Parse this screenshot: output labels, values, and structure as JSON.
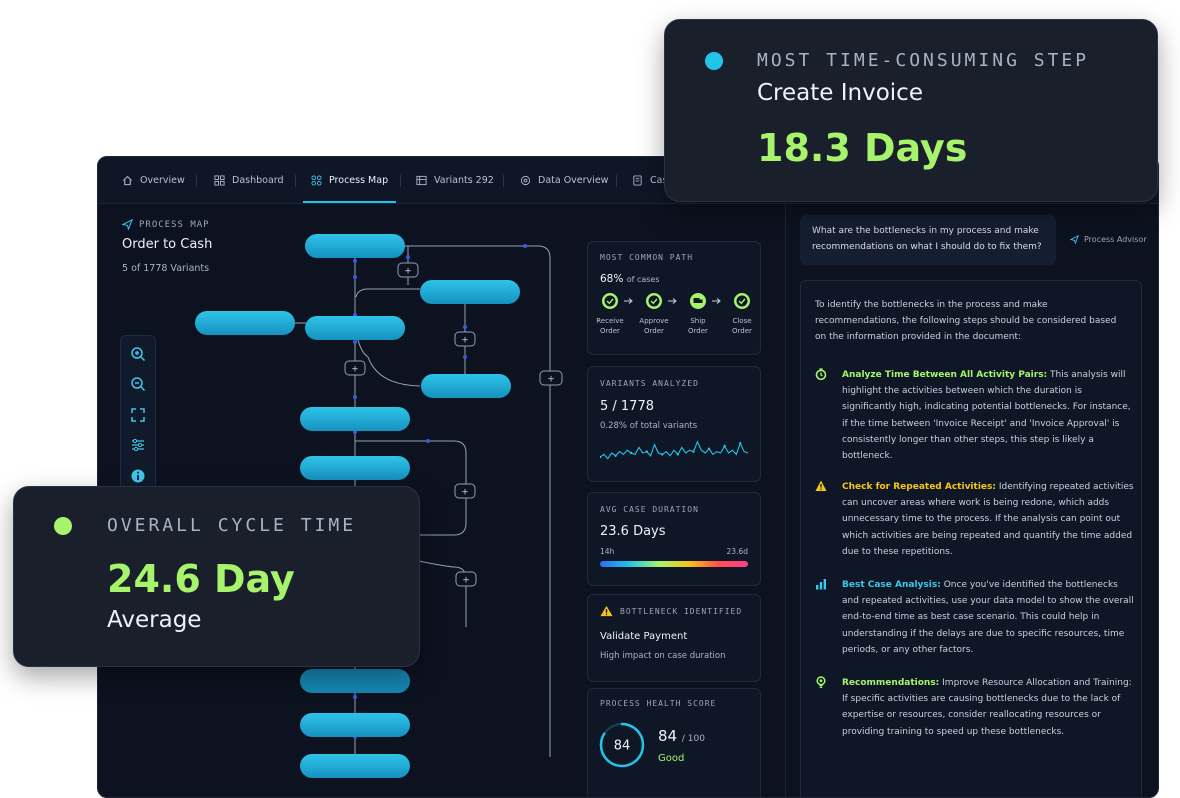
{
  "tabs": [
    {
      "label": "Overview",
      "icon": "home-icon"
    },
    {
      "label": "Dashboard",
      "icon": "dashboard-icon"
    },
    {
      "label": "Process Map",
      "icon": "process-map-icon"
    },
    {
      "label": "Variants 292",
      "icon": "variants-icon"
    },
    {
      "label": "Data Overview",
      "icon": "data-overview-icon"
    },
    {
      "label": "Cas",
      "icon": "cases-icon"
    }
  ],
  "active_tab": "Process Map",
  "process_map": {
    "header": "PROCESS MAP",
    "title": "Order to Cash",
    "subtitle": "5 of 1778 Variants"
  },
  "tools": [
    "zoom-in-icon",
    "zoom-out-icon",
    "fit-view-icon",
    "filter-sliders-icon",
    "info-icon"
  ],
  "metrics": {
    "common_path": {
      "label": "MOST COMMON PATH",
      "percent": "68%",
      "percent_suffix": "of cases",
      "steps": [
        {
          "line1": "Receive",
          "line2": "Order"
        },
        {
          "line1": "Approve",
          "line2": "Order"
        },
        {
          "line1": "Ship",
          "line2": "Order"
        },
        {
          "line1": "Close",
          "line2": "Order"
        }
      ],
      "step_icons": [
        "check-circle-icon",
        "check-circle-icon",
        "truck-icon",
        "check-circle-icon"
      ]
    },
    "variants": {
      "label": "VARIANTS ANALYZED",
      "value": "5 / 1778",
      "sub": "0.28% of total variants"
    },
    "duration": {
      "label": "AVG CASE DURATION",
      "value": "23.6 Days",
      "min_label": "14h",
      "max_label": "23.6d"
    },
    "bottleneck": {
      "label": "BOTTLENECK IDENTIFIED",
      "value": "Validate Payment",
      "sub": "High impact on case duration"
    },
    "health": {
      "label": "PROCESS HEALTH SCORE",
      "score": "84",
      "value": "84",
      "max": "/ 100",
      "status": "Good",
      "fraction": 0.84
    }
  },
  "chat": {
    "question": "What are the bottlenecks in my process and make recommendations on what I should do to fix them?",
    "advisor": "Process Advisor",
    "intro": "To identify the bottlenecks in the process and make recommendations, the following steps should be considered based on the information provided in the document:",
    "items": [
      {
        "title": "Analyze Time Between All Activity Pairs:",
        "text": " This analysis will highlight the activities between which the duration is significantly high, indicating potential bottlenecks. For instance, if the time between 'Invoice Receipt' and 'Invoice Approval' is consistently longer than other steps, this step is likely a bottleneck.",
        "icon": "stopwatch-icon",
        "color": "#a7f36b"
      },
      {
        "title": "Check for Repeated Activities:",
        "text": " Identifying repeated activities can uncover areas where work is being redone, which adds unnecessary time to the process. If the analysis can point out which activities are being repeated and quantify the time added due to these repetitions.",
        "icon": "warning-icon",
        "color": "#f5c518"
      },
      {
        "title": "Best Case Analysis:",
        "text": " Once you've identified the bottlenecks and repeated activities, use your data model to show the overall end-to-end time as best case scenario. This could help in understanding if the delays are due to specific resources, time periods, or any other factors.",
        "icon": "bar-chart-icon",
        "color": "#3ec7ea"
      },
      {
        "title": "Recommendations:",
        "text": " Improve Resource Allocation and Training: If specific activities are causing bottlenecks due to the lack of expertise or resources, consider reallocating resources or providing training to speed up these bottlenecks.",
        "icon": "lightbulb-icon",
        "color": "#a7f36b"
      }
    ]
  },
  "overlay_top": {
    "label": "MOST TIME-CONSUMING STEP",
    "step": "Create Invoice",
    "value": "18.3 Days",
    "dot_color": "#22c4e8"
  },
  "overlay_bottom": {
    "label": "OVERALL CYCLE TIME",
    "value": "24.6 Day",
    "sub": "Average",
    "dot_color": "#a7f36b"
  },
  "colors": {
    "accent": "#22c4e8",
    "green": "#a7f36b",
    "background": "#0c1220"
  },
  "sparkline": [
    0.35,
    0.45,
    0.3,
    0.5,
    0.4,
    0.55,
    0.45,
    0.6,
    0.5,
    0.45,
    0.7,
    0.5,
    0.55,
    0.4,
    0.8,
    0.5,
    0.45,
    0.55,
    0.4,
    0.6,
    0.45,
    0.7,
    0.5,
    0.6,
    0.55,
    0.9,
    0.6,
    0.5,
    0.65,
    0.45,
    0.55,
    0.5,
    0.75,
    0.5,
    0.6,
    0.45,
    0.85,
    0.55,
    0.5
  ]
}
